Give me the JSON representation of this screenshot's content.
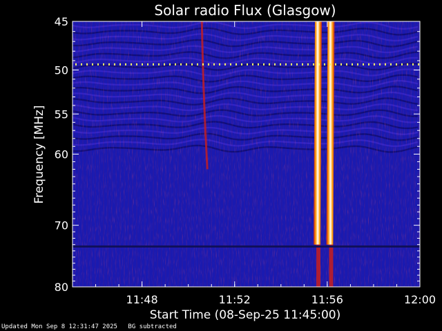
{
  "chart_data": {
    "type": "heatmap",
    "title": "Solar radio Flux (Glasgow)",
    "xlabel": "Start Time (08-Sep-25 11:45:00)",
    "ylabel": "Frequency [MHz]",
    "xlim": [
      "11:45",
      "12:00"
    ],
    "ylim": [
      45,
      80
    ],
    "y_scale": "log",
    "y_inverted": true,
    "x_ticks": [
      "11:48",
      "11:52",
      "11:56",
      "12:00"
    ],
    "y_ticks": [
      45,
      50,
      55,
      60,
      70,
      80
    ],
    "colormap": [
      "#1a1ab0",
      "#c81e1e",
      "#ff9a00",
      "#ffff66",
      "#ffffff"
    ],
    "background_color": "#1a1ab0",
    "features": [
      {
        "kind": "burst",
        "time": "11:55:37",
        "freq_range": [
          45,
          80
        ],
        "intensity": "high"
      },
      {
        "kind": "burst",
        "time": "11:56:10",
        "freq_range": [
          45,
          80
        ],
        "intensity": "high"
      },
      {
        "kind": "faint-drift",
        "time": "11:50:35",
        "freq_range": [
          45,
          62
        ],
        "intensity": "low"
      },
      {
        "kind": "interference-line",
        "freq": 49.4
      },
      {
        "kind": "interference-line",
        "freq": 73.3
      }
    ]
  },
  "footer": {
    "updated": "Updated Mon Sep  8 12:31:47 2025",
    "note": "BG subtracted"
  }
}
